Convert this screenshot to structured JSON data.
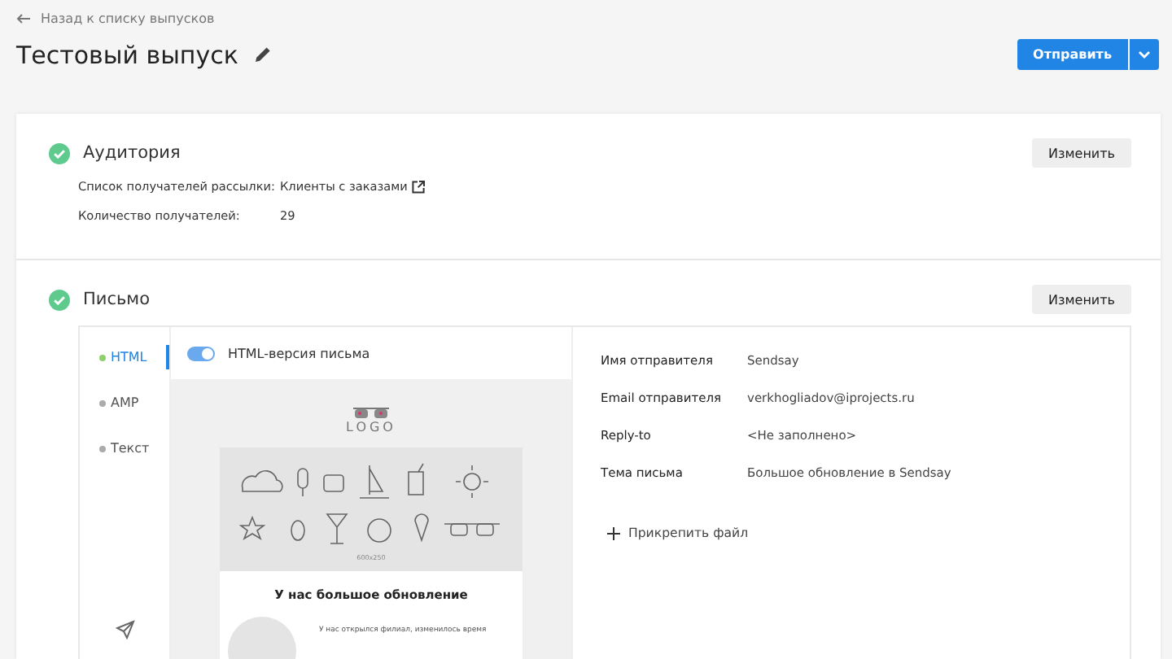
{
  "back_link": "Назад к списку выпусков",
  "title": "Тестовый выпуск",
  "send_button": "Отправить",
  "sections": [
    {
      "kind": "audience",
      "title": "Аудитория",
      "complete": true,
      "edit_button": "Изменить",
      "fields": [
        {
          "label": "Список получателей рассылки:",
          "value": "Клиенты с заказами",
          "link": true
        },
        {
          "label": "Количество получателей:",
          "value": "29",
          "link": false
        }
      ]
    },
    {
      "kind": "letter",
      "title": "Письмо",
      "complete": true,
      "edit_button": "Изменить"
    }
  ],
  "letter": {
    "versions": [
      {
        "label": "HTML",
        "selected": true
      },
      {
        "label": "AMP",
        "selected": false
      },
      {
        "label": "Текст",
        "selected": false
      }
    ],
    "toggle": {
      "label": "HTML-версия письма",
      "on": true
    },
    "preview": {
      "logo": "LOGO",
      "banner_size": "600x250",
      "heading": "У нас большое обновление",
      "body": "У нас открылся филиал, изменилось время"
    },
    "details": [
      {
        "label": "Имя отправителя",
        "value": "Sendsay"
      },
      {
        "label": "Email отправителя",
        "value": "verkhogliadov@iprojects.ru"
      },
      {
        "label": "Reply-to",
        "value": "<Не заполнено>"
      },
      {
        "label": "Тема письма",
        "value": "Большое обновление в Sendsay"
      }
    ],
    "attach": "Прикрепить файл"
  }
}
